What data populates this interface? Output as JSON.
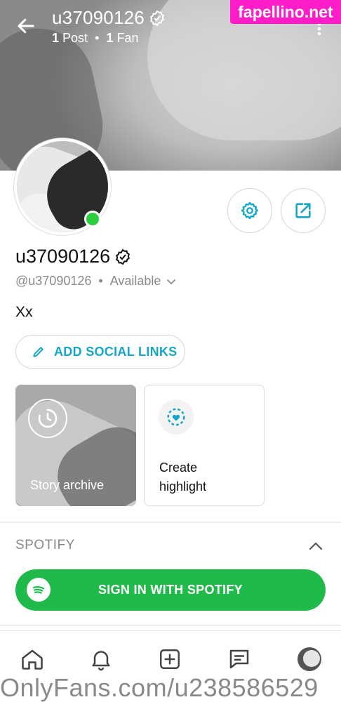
{
  "header": {
    "title": "u37090126",
    "post_count": "1",
    "post_label": "Post",
    "separator": "•",
    "fan_count": "1",
    "fan_label": "Fan"
  },
  "watermark": "fapellino.net",
  "profile": {
    "name": "u37090126",
    "handle": "@u37090126",
    "dot": "•",
    "status": "Available",
    "bio": "Xx"
  },
  "social_button": "ADD SOCIAL LINKS",
  "stories": {
    "archive_label": "Story archive",
    "highlight_line1": "Create",
    "highlight_line2": "highlight"
  },
  "spotify": {
    "section_title": "SPOTIFY",
    "button_label": "SIGN IN WITH SPOTIFY"
  },
  "footer_watermark": "OnlyFans.com/u238586529",
  "colors": {
    "accent": "#16a6c8",
    "spotify_green": "#1fba49",
    "online": "#2ecc40",
    "watermark_bg": "#ff1dc8"
  },
  "icons": {
    "back": "arrow-left-icon",
    "menu": "more-vertical-icon",
    "verified": "verified-badge-icon",
    "settings": "gear-icon",
    "share": "share-icon",
    "pencil": "pencil-icon",
    "clock": "clock-icon",
    "heart": "heart-icon",
    "chevron": "chevron-up-icon",
    "spotify": "spotify-icon",
    "home": "home-icon",
    "bell": "bell-icon",
    "add": "add-square-icon",
    "messages": "messages-icon"
  }
}
